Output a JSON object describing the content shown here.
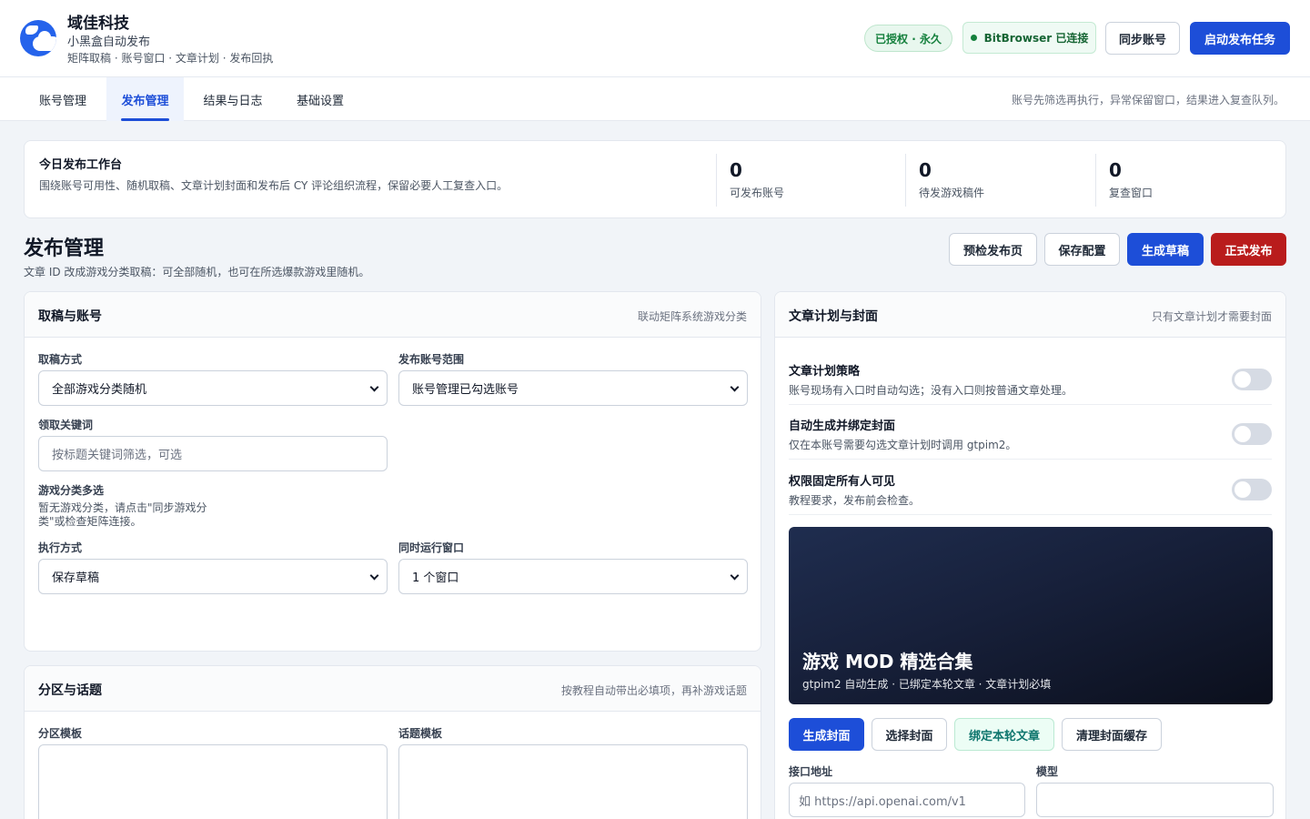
{
  "app": {
    "brand": "域佳科技",
    "subtitle": "小黑盒自动发布",
    "description": "矩阵取稿 · 账号窗口 · 文章计划 · 发布回执"
  },
  "header": {
    "license_badge": "已授权 · 永久",
    "browser_status": "BitBrowser 已连接",
    "sync_button": "同步账号",
    "start_button": "启动发布任务"
  },
  "tabs": [
    {
      "label": "账号管理",
      "active": false
    },
    {
      "label": "发布管理",
      "active": true
    },
    {
      "label": "结果与日志",
      "active": false
    },
    {
      "label": "基础设置",
      "active": false
    }
  ],
  "tab_hint": "账号先筛选再执行，异常保留窗口，结果进入复查队列。",
  "workbench": {
    "title": "今日发布工作台",
    "description": "围绕账号可用性、随机取稿、文章计划封面和发布后 CY 评论组织流程，保留必要人工复查入口。",
    "stats": [
      {
        "value": "0",
        "label": "可发布账号"
      },
      {
        "value": "0",
        "label": "待发游戏稿件"
      },
      {
        "value": "0",
        "label": "复查窗口"
      }
    ]
  },
  "page": {
    "title": "发布管理",
    "subtitle": "文章 ID 改成游戏分类取稿：可全部随机，也可在所选爆款游戏里随机。",
    "actions": {
      "precheck": "预检发布页",
      "save": "保存配置",
      "draft": "生成草稿",
      "publish": "正式发布"
    }
  },
  "draft_card": {
    "title": "取稿与账号",
    "hint": "联动矩阵系统游戏分类",
    "fetch_mode_label": "取稿方式",
    "fetch_mode_value": "全部游戏分类随机",
    "account_scope_label": "发布账号范围",
    "account_scope_value": "账号管理已勾选账号",
    "keyword_label": "领取关键词",
    "keyword_placeholder": "按标题关键词筛选，可选",
    "category_label": "游戏分类多选",
    "category_note_1": "暂无游戏分类，请点击\"同步游戏分",
    "category_note_2": "类\"或检查矩阵连接。",
    "exec_mode_label": "执行方式",
    "exec_mode_value": "保存草稿",
    "concurrency_label": "同时运行窗口",
    "concurrency_value": "1 个窗口"
  },
  "topic_card": {
    "title": "分区与话题",
    "hint": "按教程自动带出必填项，再补游戏话题",
    "section_label": "分区模板",
    "topic_label": "话题模板"
  },
  "plan_card": {
    "title": "文章计划与封面",
    "hint": "只有文章计划才需要封面",
    "options": [
      {
        "title": "文章计划策略",
        "desc": "账号现场有入口时自动勾选；没有入口则按普通文章处理。",
        "enabled": false
      },
      {
        "title": "自动生成并绑定封面",
        "desc": "仅在本账号需要勾选文章计划时调用 gtpim2。",
        "enabled": false
      },
      {
        "title": "权限固定所有人可见",
        "desc": "教程要求，发布前会检查。",
        "enabled": false
      }
    ],
    "cover_title": "游戏 MOD 精选合集",
    "cover_subtitle": "gtpim2 自动生成 · 已绑定本轮文章 · 文章计划必填",
    "buttons": {
      "generate": "生成封面",
      "select": "选择封面",
      "bind": "绑定本轮文章",
      "clear": "清理封面缓存"
    },
    "api_label": "接口地址",
    "api_placeholder": "如 https://api.openai.com/v1",
    "model_label": "模型",
    "model_value": ""
  },
  "colors": {
    "primary": "#1d4ed8",
    "danger": "#b91c1c",
    "success": "#15803d",
    "background": "#f1f4f8"
  }
}
